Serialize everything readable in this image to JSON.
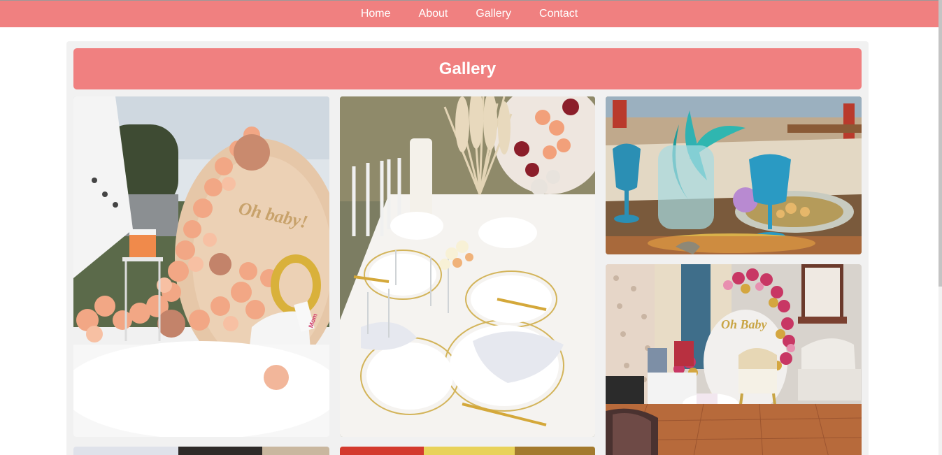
{
  "nav": {
    "items": [
      {
        "label": "Home"
      },
      {
        "label": "About"
      },
      {
        "label": "Gallery"
      },
      {
        "label": "Contact"
      }
    ]
  },
  "gallery": {
    "title": "Gallery",
    "photo_1": {
      "backdrop_text": "Oh baby!",
      "sash_text": "Mom"
    },
    "photo_4": {
      "backdrop_text": "Oh Baby"
    }
  },
  "colors": {
    "accent": "#f08080",
    "panel": "#f1f1f1",
    "text_on_accent": "#ffffff"
  }
}
